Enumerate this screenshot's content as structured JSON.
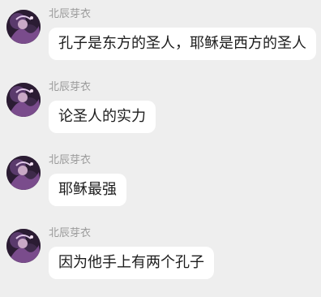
{
  "messages": [
    {
      "sender": "北辰芽衣",
      "text": "孔子是东方的圣人，耶稣是西方的圣人"
    },
    {
      "sender": "北辰芽衣",
      "text": "论圣人的实力"
    },
    {
      "sender": "北辰芽衣",
      "text": "耶稣最强"
    },
    {
      "sender": "北辰芽衣",
      "text": "因为他手上有两个孔子"
    }
  ],
  "colors": {
    "background": "#eeeeee",
    "bubble": "#ffffff",
    "sender_name": "#9a9a9a",
    "message_text": "#1c1c1c",
    "avatar_base": "#2b1c33",
    "avatar_accent": "#8a5a9e"
  }
}
